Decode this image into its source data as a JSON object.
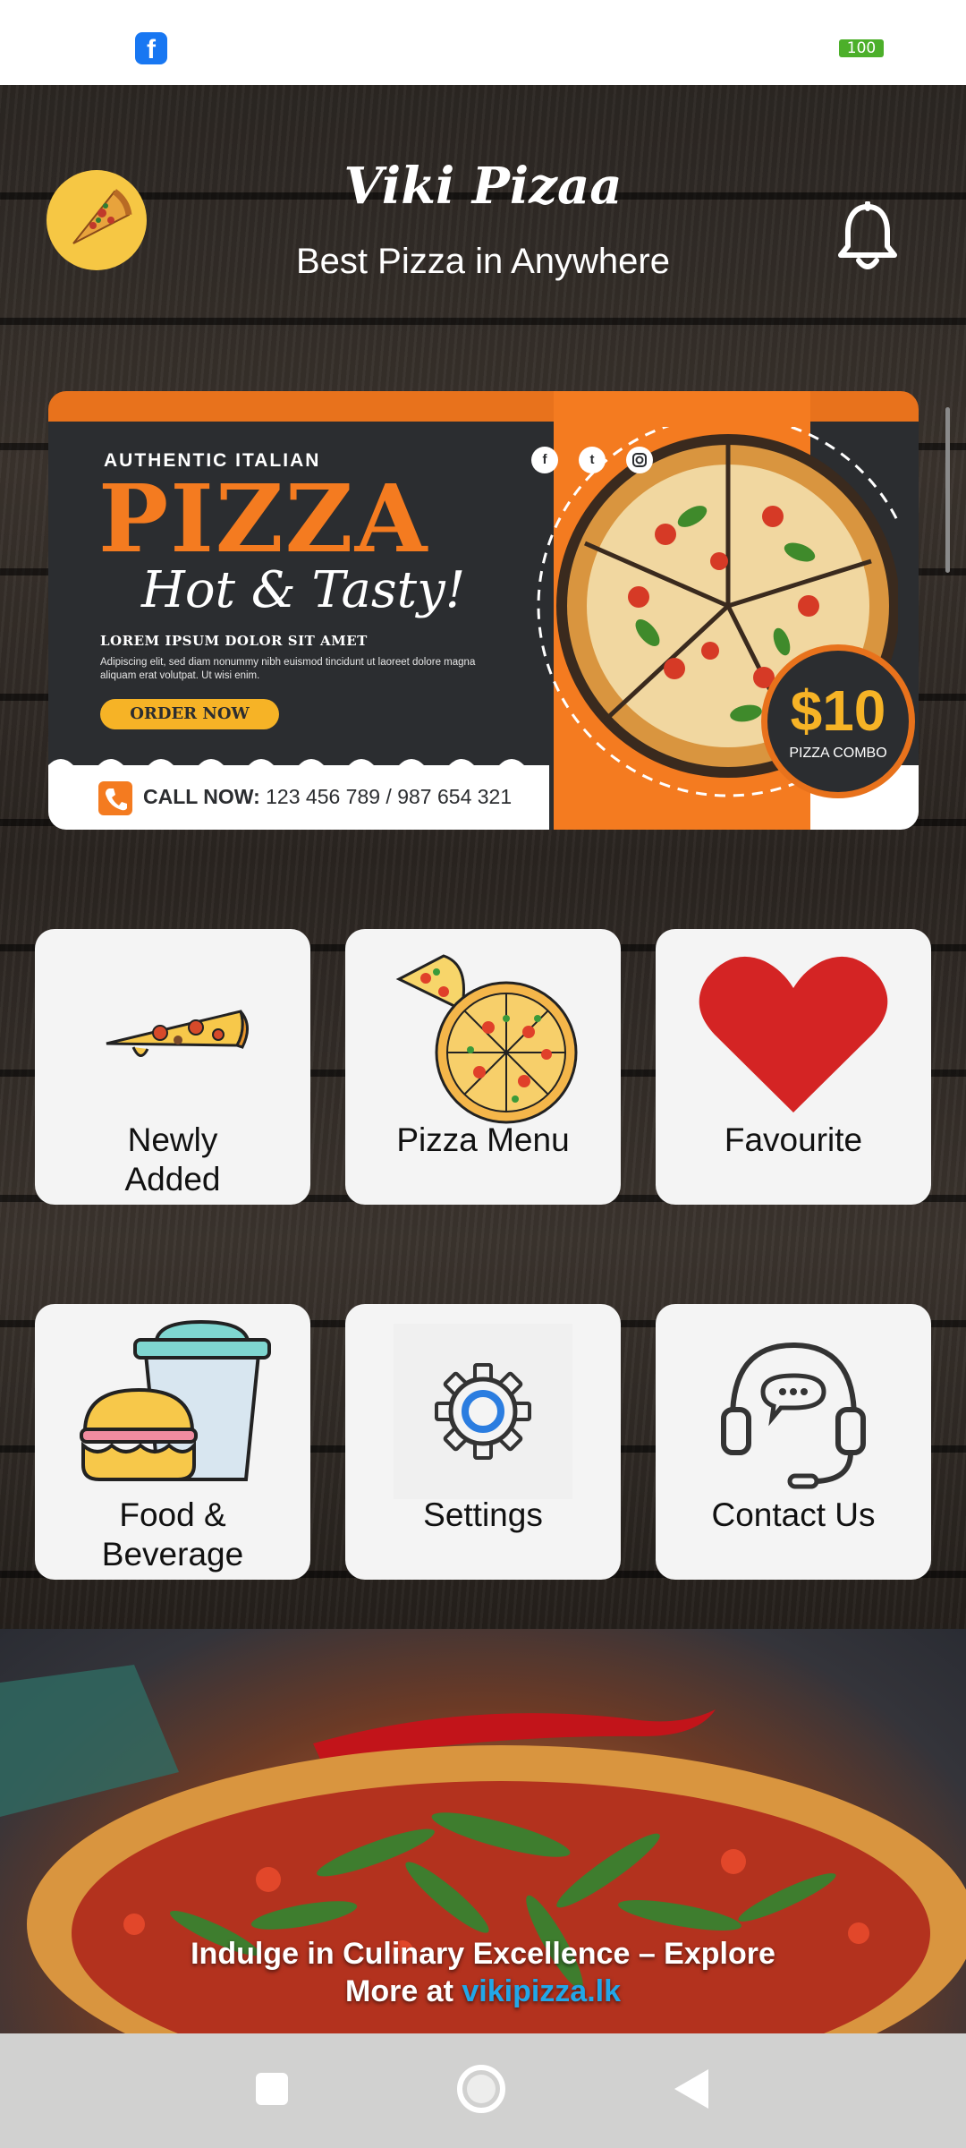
{
  "status_bar": {
    "app_icon": "facebook-icon",
    "battery": "100"
  },
  "header": {
    "title": "Viki Pizaa",
    "subtitle": "Best Pizza in Anywhere",
    "logo_icon": "pizza-slice-logo",
    "notification_icon": "bell-icon"
  },
  "banner": {
    "kicker": "AUTHENTIC ITALIAN",
    "headline": "PIZZA",
    "tagline": "Hot & Tasty!",
    "lorem_heading": "LOREM IPSUM DOLOR SIT AMET",
    "lorem_body": "Adipiscing elit, sed diam nonummy nibh euismod tincidunt ut laoreet dolore magna aliquam erat volutpat. Ut wisi enim.",
    "order_button": "ORDER NOW",
    "call_label": "CALL NOW:",
    "call_numbers": "123 456 789 / 987 654 321",
    "price": "$10",
    "price_caption": "PIZZA COMBO",
    "social": [
      "f",
      "t",
      "ig"
    ],
    "colors": {
      "orange": "#f47b20",
      "dark": "#2b2d30",
      "yellow": "#f6b326"
    }
  },
  "tiles": [
    {
      "line1": "Newly",
      "line2": "Added",
      "icon": "pizza-slice-icon"
    },
    {
      "line1": "Pizza Menu",
      "line2": "",
      "icon": "pizza-pie-icon"
    },
    {
      "line1": "Favourite",
      "line2": "",
      "icon": "heart-icon"
    },
    {
      "line1": "Food &",
      "line2": "Beverage",
      "icon": "burger-drink-icon"
    },
    {
      "line1": "Settings",
      "line2": "",
      "icon": "gear-icon"
    },
    {
      "line1": "Contact Us",
      "line2": "",
      "icon": "headset-icon"
    }
  ],
  "footer": {
    "promo_line1": "Indulge in Culinary Excellence – Explore",
    "promo_line2_prefix": "More at ",
    "promo_link": "vikipizza.lk",
    "link_color": "#22a7e8"
  },
  "nav_bar": [
    "recents-icon",
    "home-icon",
    "back-icon"
  ]
}
